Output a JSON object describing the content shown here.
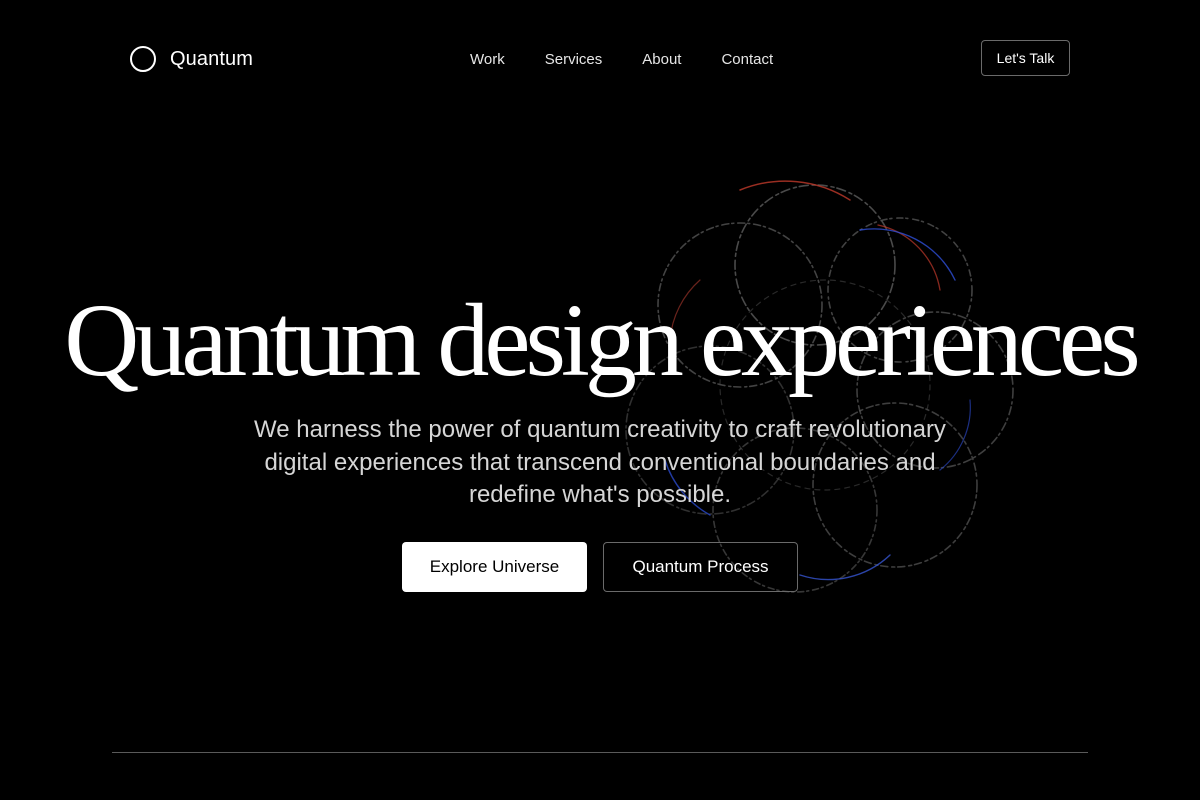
{
  "header": {
    "logo_text": "Quantum",
    "nav": [
      {
        "label": "Work"
      },
      {
        "label": "Services"
      },
      {
        "label": "About"
      },
      {
        "label": "Contact"
      }
    ],
    "cta_label": "Let's Talk"
  },
  "hero": {
    "title": "Quantum design experiences",
    "subtitle": "We harness the power of quantum creativity to craft revolutionary digital experiences that transcend conventional boundaries and redefine what's possible.",
    "primary_button": "Explore Universe",
    "secondary_button": "Quantum Process"
  },
  "colors": {
    "background": "#000000",
    "text": "#ffffff",
    "muted_text": "#d6d6d6",
    "border": "#6a6a6a",
    "orbit_accents": [
      "#c0392b",
      "#2e4fd8",
      "#8a8a8a"
    ]
  },
  "icons": {
    "logo": "ring-logo-icon",
    "decoration": "orbit-rings-graphic"
  }
}
